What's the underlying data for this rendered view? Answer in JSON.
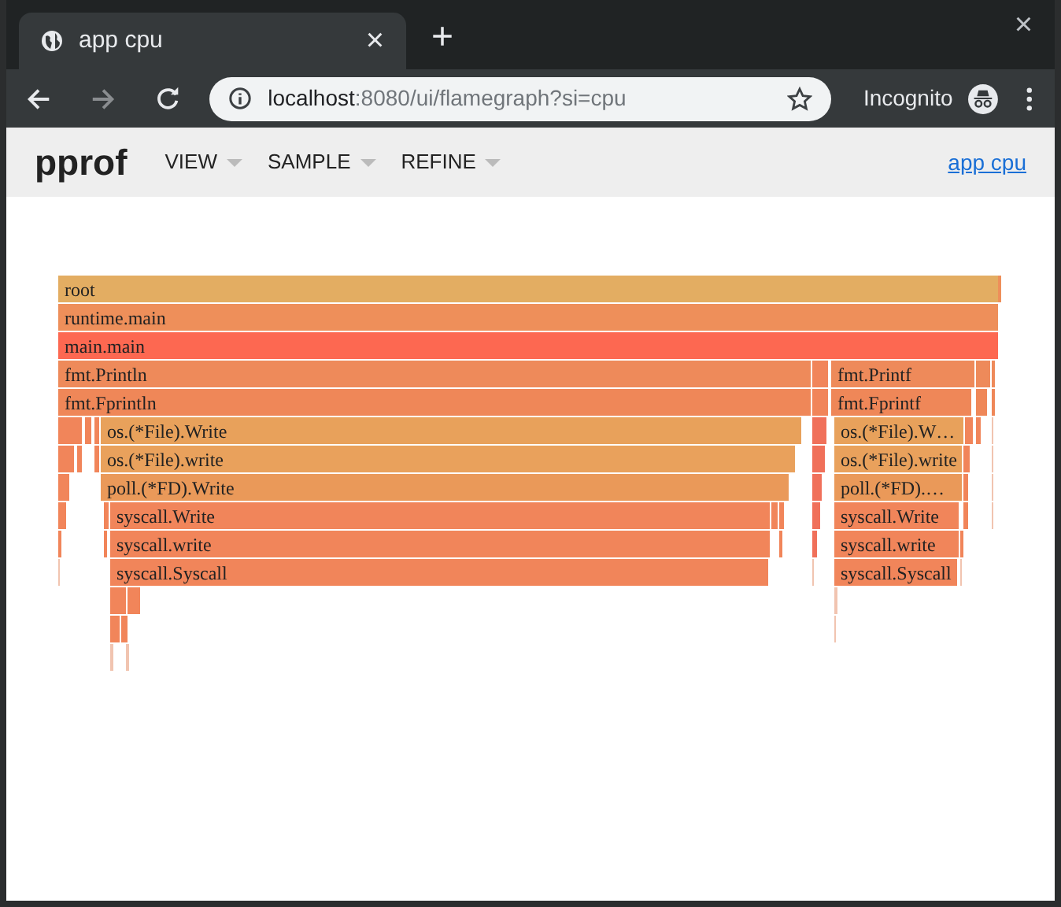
{
  "browser": {
    "tab": {
      "title": "app cpu",
      "close": "×"
    },
    "new_tab": "+",
    "window_close": "×",
    "address": {
      "host": "localhost",
      "path": ":8080/ui/flamegraph?si=cpu"
    },
    "profile": "Incognito"
  },
  "header": {
    "logo": "pprof",
    "menus": [
      {
        "label": "VIEW"
      },
      {
        "label": "SAMPLE"
      },
      {
        "label": "REFINE"
      }
    ],
    "link": "app cpu"
  },
  "flame_graph": {
    "root": {
      "label": "root",
      "color": "#e3ad62",
      "children": [
        {
          "label": "runtime.main",
          "color": "#ee8f5a",
          "children": [
            {
              "label": "main.main",
              "color": "#fd6851",
              "children": [
                {
                  "label": "fmt.Println",
                  "color": "#ee8a5a",
                  "children": [
                    {
                      "label": "fmt.Fprintln",
                      "color": "#ef8758",
                      "children": [
                        {
                          "label": "os.(*File).Write",
                          "color": "#e8a15b",
                          "children": [
                            {
                              "label": "os.(*File).write",
                              "color": "#e9a15c",
                              "children": [
                                {
                                  "label": "poll.(*FD).Write",
                                  "color": "#ea9959",
                                  "children": [
                                    {
                                      "label": "syscall.Write",
                                      "color": "#f1855a",
                                      "children": [
                                        {
                                          "label": "syscall.write",
                                          "color": "#f1855a",
                                          "children": [
                                            {
                                              "label": "syscall.Syscall",
                                              "color": "#f1855a"
                                            }
                                          ]
                                        }
                                      ]
                                    }
                                  ]
                                }
                              ]
                            }
                          ]
                        }
                      ]
                    }
                  ]
                },
                {
                  "label": "fmt.Printf",
                  "color": "#ee8a5a",
                  "children": [
                    {
                      "label": "fmt.Fprintf",
                      "color": "#ef8758",
                      "children": [
                        {
                          "label": "os.(*File).W…",
                          "color": "#e8a15b",
                          "children": [
                            {
                              "label": "os.(*File).write",
                              "color": "#e9a15c",
                              "children": [
                                {
                                  "label": "poll.(*FD).…",
                                  "color": "#ea9959",
                                  "children": [
                                    {
                                      "label": "syscall.Write",
                                      "color": "#f1855a",
                                      "children": [
                                        {
                                          "label": "syscall.write",
                                          "color": "#f1855a",
                                          "children": [
                                            {
                                              "label": "syscall.Syscall",
                                              "color": "#f1855a"
                                            }
                                          ]
                                        }
                                      ]
                                    }
                                  ]
                                }
                              ]
                            }
                          ]
                        }
                      ]
                    }
                  ]
                }
              ]
            }
          ]
        }
      ]
    }
  }
}
